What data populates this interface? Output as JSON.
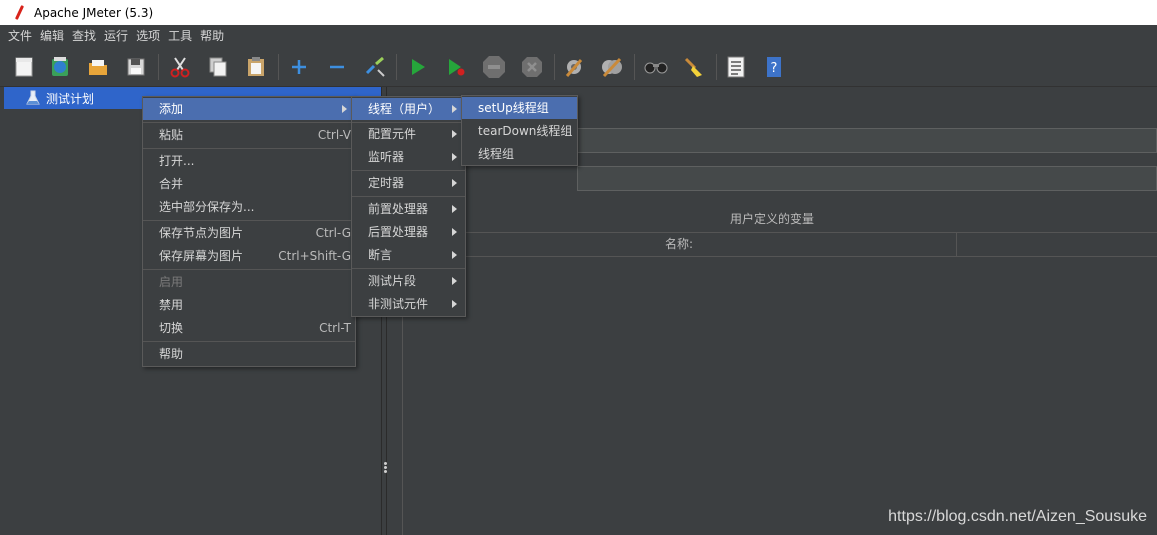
{
  "window": {
    "title": "Apache JMeter (5.3)"
  },
  "menubar": [
    "文件",
    "编辑",
    "查找",
    "运行",
    "选项",
    "工具",
    "帮助"
  ],
  "toolbar": [
    {
      "name": "new-icon"
    },
    {
      "name": "templates-icon"
    },
    {
      "name": "open-icon"
    },
    {
      "name": "save-icon"
    },
    {
      "name": "cut-icon"
    },
    {
      "name": "copy-icon"
    },
    {
      "name": "paste-icon"
    },
    {
      "name": "expand-icon"
    },
    {
      "name": "collapse-icon"
    },
    {
      "name": "toggle-icon"
    },
    {
      "name": "start-icon"
    },
    {
      "name": "start-no-pause-icon"
    },
    {
      "name": "stop-icon"
    },
    {
      "name": "shutdown-icon"
    },
    {
      "name": "clear-icon"
    },
    {
      "name": "clear-all-icon"
    },
    {
      "name": "search-icon"
    },
    {
      "name": "reset-search-icon"
    },
    {
      "name": "function-helper-icon"
    },
    {
      "name": "help-icon"
    }
  ],
  "tree": {
    "root_label": "测试计划"
  },
  "right_panel": {
    "section_title": "用户定义的变量",
    "table_col_name": "名称:"
  },
  "context_menu": {
    "items": [
      {
        "label": "添加",
        "has_submenu": true
      },
      {
        "label": "粘贴",
        "shortcut": "Ctrl-V"
      },
      {
        "label": "打开..."
      },
      {
        "label": "合并"
      },
      {
        "label": "选中部分保存为..."
      },
      {
        "label": "保存节点为图片",
        "shortcut": "Ctrl-G"
      },
      {
        "label": "保存屏幕为图片",
        "shortcut": "Ctrl+Shift-G"
      },
      {
        "label": "启用",
        "disabled": true
      },
      {
        "label": "禁用"
      },
      {
        "label": "切换",
        "shortcut": "Ctrl-T"
      },
      {
        "label": "帮助"
      }
    ]
  },
  "add_submenu": {
    "items": [
      {
        "label": "线程（用户）"
      },
      {
        "label": "配置元件"
      },
      {
        "label": "监听器"
      },
      {
        "label": "定时器"
      },
      {
        "label": "前置处理器"
      },
      {
        "label": "后置处理器"
      },
      {
        "label": "断言"
      },
      {
        "label": "测试片段"
      },
      {
        "label": "非测试元件"
      }
    ]
  },
  "threads_submenu": {
    "items": [
      {
        "label": "setUp线程组"
      },
      {
        "label": "tearDown线程组"
      },
      {
        "label": "线程组"
      }
    ]
  },
  "watermark": "https://blog.csdn.net/Aizen_Sousuke",
  "colors": {
    "selection": "#4b6eaf",
    "tree_selection": "#2f65ca",
    "background": "#3c3f41"
  }
}
